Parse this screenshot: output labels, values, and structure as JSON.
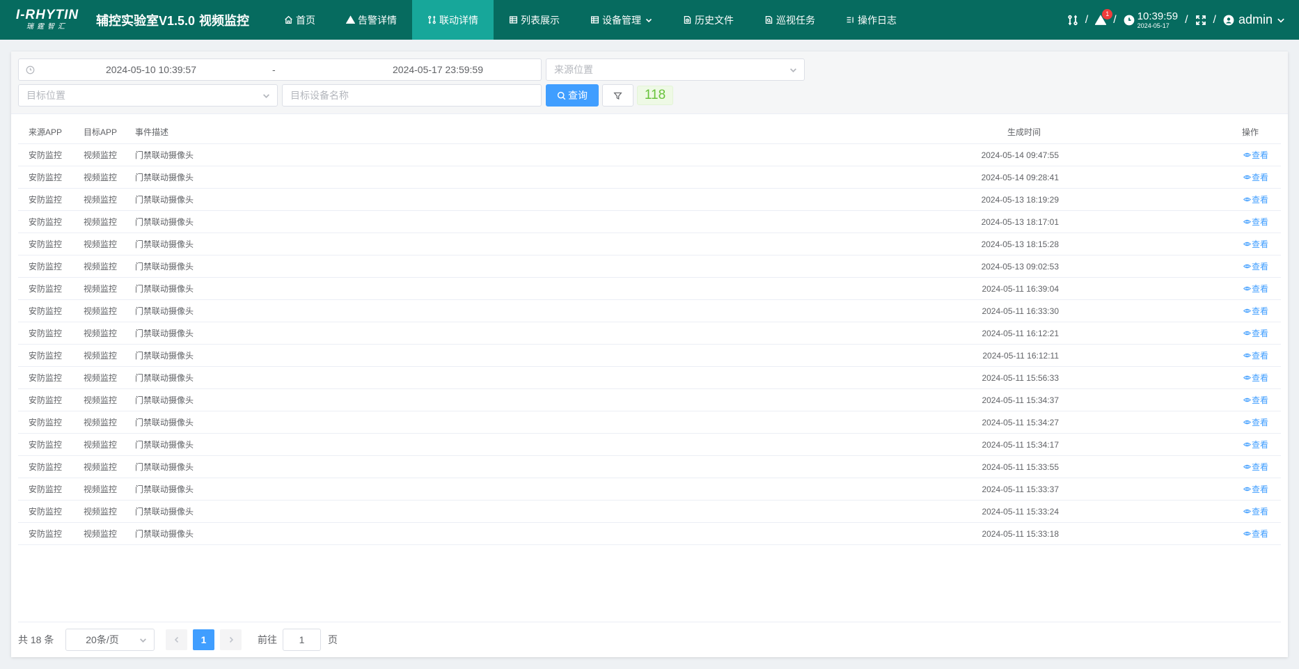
{
  "header": {
    "logo_main": "I-RHYTIN",
    "logo_sub": "瑞霆智汇",
    "system_title": "辅控实验室V1.5.0",
    "system_subtitle": "视频监控",
    "nav": [
      {
        "label": "首页",
        "icon": "home-icon",
        "active": false
      },
      {
        "label": "告警详情",
        "icon": "warning-icon",
        "active": false
      },
      {
        "label": "联动详情",
        "icon": "link-icon",
        "active": true
      },
      {
        "label": "列表展示",
        "icon": "list-icon",
        "active": false
      },
      {
        "label": "设备管理",
        "icon": "device-icon",
        "active": false,
        "dropdown": true
      },
      {
        "label": "历史文件",
        "icon": "file-icon",
        "active": false
      },
      {
        "label": "巡视任务",
        "icon": "task-icon",
        "active": false
      },
      {
        "label": "操作日志",
        "icon": "log-icon",
        "active": false
      }
    ],
    "alarm_count": "1",
    "clock_time": "10:39:59",
    "clock_date": "2024-05-17",
    "username": "admin",
    "separator": "/"
  },
  "filters": {
    "start_date": "2024-05-10 10:39:57",
    "range_separator": "-",
    "end_date": "2024-05-17 23:59:59",
    "source_location_placeholder": "来源位置",
    "target_location_placeholder": "目标位置",
    "target_device_placeholder": "目标设备名称",
    "query_label": "查询",
    "result_count": "118"
  },
  "table": {
    "columns": {
      "source_app": "来源APP",
      "target_app": "目标APP",
      "description": "事件描述",
      "time": "生成时间",
      "action": "操作"
    },
    "action_label": "查看",
    "rows": [
      {
        "source": "安防监控",
        "target": "视频监控",
        "desc": "门禁联动摄像头",
        "time": "2024-05-14 09:47:55"
      },
      {
        "source": "安防监控",
        "target": "视频监控",
        "desc": "门禁联动摄像头",
        "time": "2024-05-14 09:28:41"
      },
      {
        "source": "安防监控",
        "target": "视频监控",
        "desc": "门禁联动摄像头",
        "time": "2024-05-13 18:19:29"
      },
      {
        "source": "安防监控",
        "target": "视频监控",
        "desc": "门禁联动摄像头",
        "time": "2024-05-13 18:17:01"
      },
      {
        "source": "安防监控",
        "target": "视频监控",
        "desc": "门禁联动摄像头",
        "time": "2024-05-13 18:15:28"
      },
      {
        "source": "安防监控",
        "target": "视频监控",
        "desc": "门禁联动摄像头",
        "time": "2024-05-13 09:02:53"
      },
      {
        "source": "安防监控",
        "target": "视频监控",
        "desc": "门禁联动摄像头",
        "time": "2024-05-11 16:39:04"
      },
      {
        "source": "安防监控",
        "target": "视频监控",
        "desc": "门禁联动摄像头",
        "time": "2024-05-11 16:33:30"
      },
      {
        "source": "安防监控",
        "target": "视频监控",
        "desc": "门禁联动摄像头",
        "time": "2024-05-11 16:12:21"
      },
      {
        "source": "安防监控",
        "target": "视频监控",
        "desc": "门禁联动摄像头",
        "time": "2024-05-11 16:12:11"
      },
      {
        "source": "安防监控",
        "target": "视频监控",
        "desc": "门禁联动摄像头",
        "time": "2024-05-11 15:56:33"
      },
      {
        "source": "安防监控",
        "target": "视频监控",
        "desc": "门禁联动摄像头",
        "time": "2024-05-11 15:34:37"
      },
      {
        "source": "安防监控",
        "target": "视频监控",
        "desc": "门禁联动摄像头",
        "time": "2024-05-11 15:34:27"
      },
      {
        "source": "安防监控",
        "target": "视频监控",
        "desc": "门禁联动摄像头",
        "time": "2024-05-11 15:34:17"
      },
      {
        "source": "安防监控",
        "target": "视频监控",
        "desc": "门禁联动摄像头",
        "time": "2024-05-11 15:33:55"
      },
      {
        "source": "安防监控",
        "target": "视频监控",
        "desc": "门禁联动摄像头",
        "time": "2024-05-11 15:33:37"
      },
      {
        "source": "安防监控",
        "target": "视频监控",
        "desc": "门禁联动摄像头",
        "time": "2024-05-11 15:33:24"
      },
      {
        "source": "安防监控",
        "target": "视频监控",
        "desc": "门禁联动摄像头",
        "time": "2024-05-11 15:33:18"
      }
    ]
  },
  "pagination": {
    "total": "共 18 条",
    "page_size": "20条/页",
    "current_page": "1",
    "goto_label": "前往",
    "goto_value": "1",
    "page_suffix": "页"
  },
  "colors": {
    "header_bg": "#066b5f",
    "nav_active_bg": "#17a79a",
    "primary": "#409eff",
    "badge": "#f03c3c",
    "count_text": "#67c23a"
  }
}
